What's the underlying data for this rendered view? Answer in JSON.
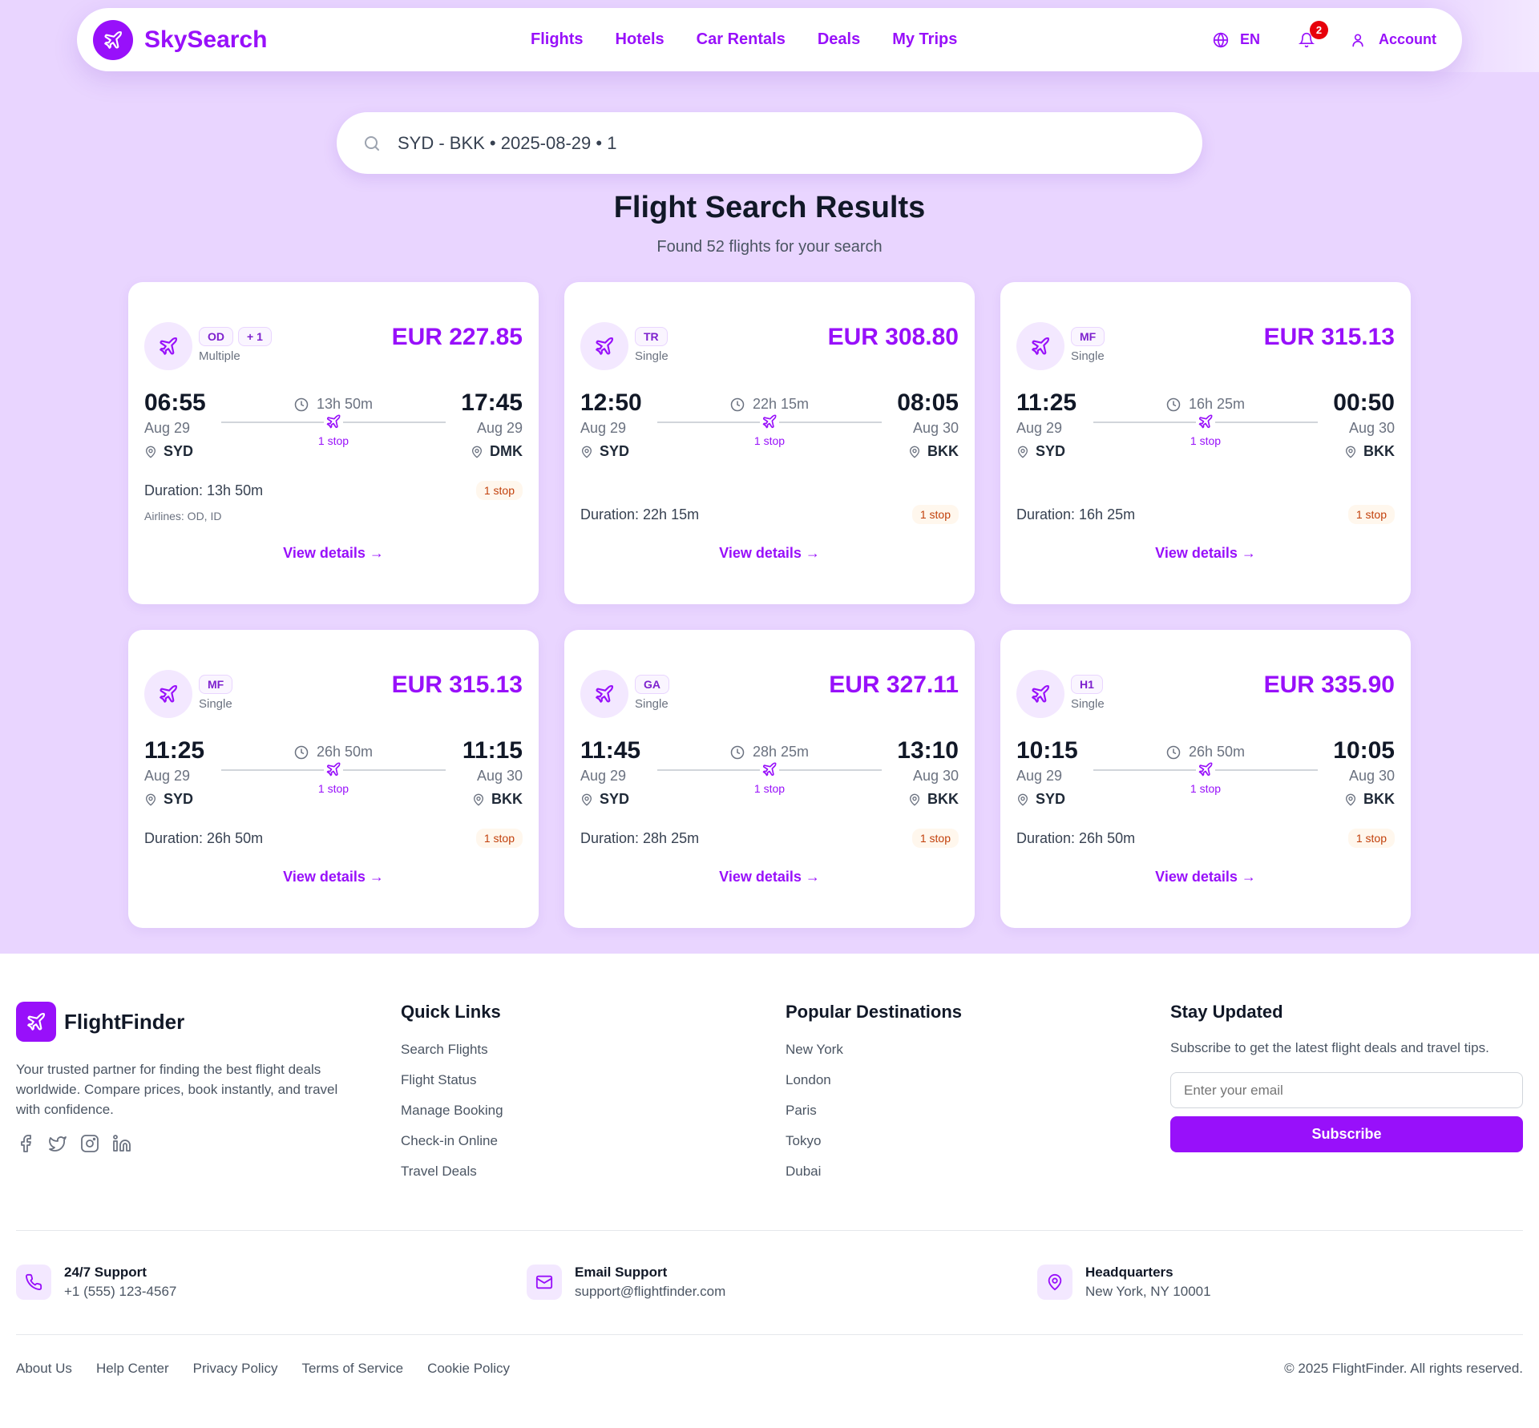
{
  "brand": {
    "name": "SkySearch",
    "color": "#9810fa"
  },
  "nav": {
    "links": [
      "Flights",
      "Hotels",
      "Car Rentals",
      "Deals",
      "My Trips"
    ],
    "language": "EN",
    "notification_count": "2",
    "account_label": "Account"
  },
  "search": {
    "value": "SYD - BKK • 2025-08-29 • 1"
  },
  "results": {
    "title": "Flight Search Results",
    "subtitle": "Found 52 flights for your search"
  },
  "flights": [
    {
      "codes": [
        "OD",
        "+ 1"
      ],
      "type": "Multiple",
      "price": "EUR 227.85",
      "dep_time": "06:55",
      "dep_date": "Aug 29",
      "dep_airport": "SYD",
      "arr_time": "17:45",
      "arr_date": "Aug 29",
      "arr_airport": "DMK",
      "flight_time": "13h 50m",
      "stops_label": "1 stop",
      "duration": "Duration: 13h 50m",
      "stop_badge": "1 stop",
      "airlines": "Airlines: OD, ID",
      "view_details": "View details →"
    },
    {
      "codes": [
        "TR"
      ],
      "type": "Single",
      "price": "EUR 308.80",
      "dep_time": "12:50",
      "dep_date": "Aug 29",
      "dep_airport": "SYD",
      "arr_time": "08:05",
      "arr_date": "Aug 30",
      "arr_airport": "BKK",
      "flight_time": "22h 15m",
      "stops_label": "1 stop",
      "duration": "Duration: 22h 15m",
      "stop_badge": "1 stop",
      "view_details": "View details →"
    },
    {
      "codes": [
        "MF"
      ],
      "type": "Single",
      "price": "EUR 315.13",
      "dep_time": "11:25",
      "dep_date": "Aug 29",
      "dep_airport": "SYD",
      "arr_time": "00:50",
      "arr_date": "Aug 30",
      "arr_airport": "BKK",
      "flight_time": "16h 25m",
      "stops_label": "1 stop",
      "duration": "Duration: 16h 25m",
      "stop_badge": "1 stop",
      "view_details": "View details →"
    },
    {
      "codes": [
        "MF"
      ],
      "type": "Single",
      "price": "EUR 315.13",
      "dep_time": "11:25",
      "dep_date": "Aug 29",
      "dep_airport": "SYD",
      "arr_time": "11:15",
      "arr_date": "Aug 30",
      "arr_airport": "BKK",
      "flight_time": "26h 50m",
      "stops_label": "1 stop",
      "duration": "Duration: 26h 50m",
      "stop_badge": "1 stop",
      "view_details": "View details →"
    },
    {
      "codes": [
        "GA"
      ],
      "type": "Single",
      "price": "EUR 327.11",
      "dep_time": "11:45",
      "dep_date": "Aug 29",
      "dep_airport": "SYD",
      "arr_time": "13:10",
      "arr_date": "Aug 30",
      "arr_airport": "BKK",
      "flight_time": "28h 25m",
      "stops_label": "1 stop",
      "duration": "Duration: 28h 25m",
      "stop_badge": "1 stop",
      "view_details": "View details →"
    },
    {
      "codes": [
        "H1"
      ],
      "type": "Single",
      "price": "EUR 335.90",
      "dep_time": "10:15",
      "dep_date": "Aug 29",
      "dep_airport": "SYD",
      "arr_time": "10:05",
      "arr_date": "Aug 30",
      "arr_airport": "BKK",
      "flight_time": "26h 50m",
      "stops_label": "1 stop",
      "duration": "Duration: 26h 50m",
      "stop_badge": "1 stop",
      "view_details": "View details →"
    }
  ],
  "footer": {
    "brand": "FlightFinder",
    "description": "Your trusted partner for finding the best flight deals worldwide. Compare prices, book instantly, and travel with confidence.",
    "socials": [
      "facebook-icon",
      "twitter-icon",
      "instagram-icon",
      "linkedin-icon"
    ],
    "quick_links": {
      "heading": "Quick Links",
      "items": [
        "Search Flights",
        "Flight Status",
        "Manage Booking",
        "Check-in Online",
        "Travel Deals"
      ]
    },
    "destinations": {
      "heading": "Popular Destinations",
      "items": [
        "New York",
        "London",
        "Paris",
        "Tokyo",
        "Dubai"
      ]
    },
    "newsletter": {
      "heading": "Stay Updated",
      "text": "Subscribe to get the latest flight deals and travel tips.",
      "placeholder": "Enter your email",
      "button": "Subscribe"
    },
    "contacts": [
      {
        "icon": "phone-icon",
        "title": "24/7 Support",
        "value": "+1 (555) 123-4567"
      },
      {
        "icon": "mail-icon",
        "title": "Email Support",
        "value": "support@flightfinder.com"
      },
      {
        "icon": "map-pin-icon",
        "title": "Headquarters",
        "value": "New York, NY 10001"
      }
    ],
    "bottom_links": [
      "About Us",
      "Help Center",
      "Privacy Policy",
      "Terms of Service",
      "Cookie Policy"
    ],
    "copyright": "© 2025 FlightFinder. All rights reserved."
  }
}
